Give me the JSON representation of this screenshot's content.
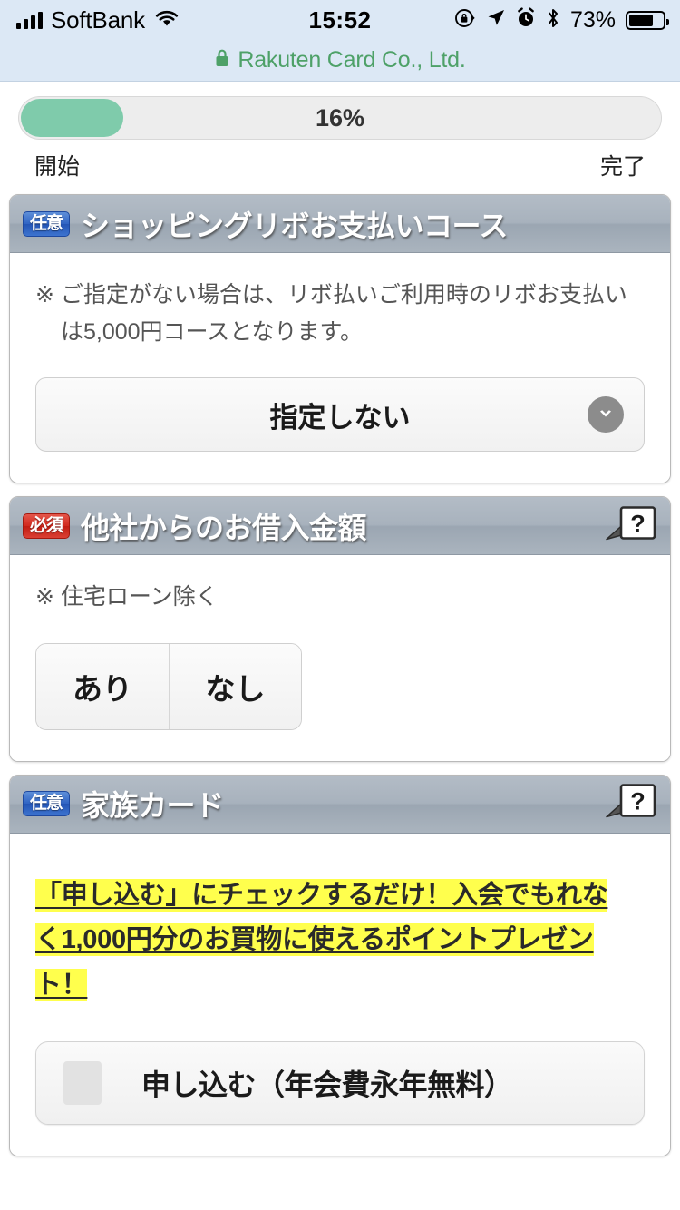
{
  "statusbar": {
    "carrier": "SoftBank",
    "time": "15:52",
    "battery_percent": "73%",
    "icons": [
      "signal-bars-icon",
      "wifi-icon",
      "rotation-lock-icon",
      "location-arrow-icon",
      "alarm-clock-icon",
      "bluetooth-icon",
      "battery-icon"
    ]
  },
  "urlbar": {
    "site_title": "Rakuten Card Co., Ltd.",
    "lock": "lock-icon"
  },
  "progress": {
    "percent_label": "16%",
    "percent_value": 16,
    "start_label": "開始",
    "end_label": "完了",
    "fill_color": "#7fcbab",
    "track_color": "#ededed"
  },
  "badges": {
    "optional": "任意",
    "required": "必須",
    "optional_color": "#2f63c4",
    "required_color": "#d1281c"
  },
  "cards": [
    {
      "badge_type": "optional",
      "title": "ショッピングリボお支払いコース",
      "has_help": false,
      "note": "※ ご指定がない場合は、リボ払いご利用時のリボお支払いは5,000円コースとなります。",
      "select_value": "指定しない"
    },
    {
      "badge_type": "required",
      "title": "他社からのお借入金額",
      "has_help": true,
      "note": "※ 住宅ローン除く",
      "segments": [
        "あり",
        "なし"
      ]
    },
    {
      "badge_type": "optional",
      "title": "家族カード",
      "has_help": true,
      "promo_lines": [
        "「申し込む」にチェックするだけ！入会でもれな",
        "く1,000円分のお買物に使えるポイントプレゼン",
        "ト！"
      ],
      "promo_highlight_color": "#ffff4d",
      "checkbox_label": "申し込む（年会費永年無料）",
      "checkbox_checked": false
    }
  ]
}
